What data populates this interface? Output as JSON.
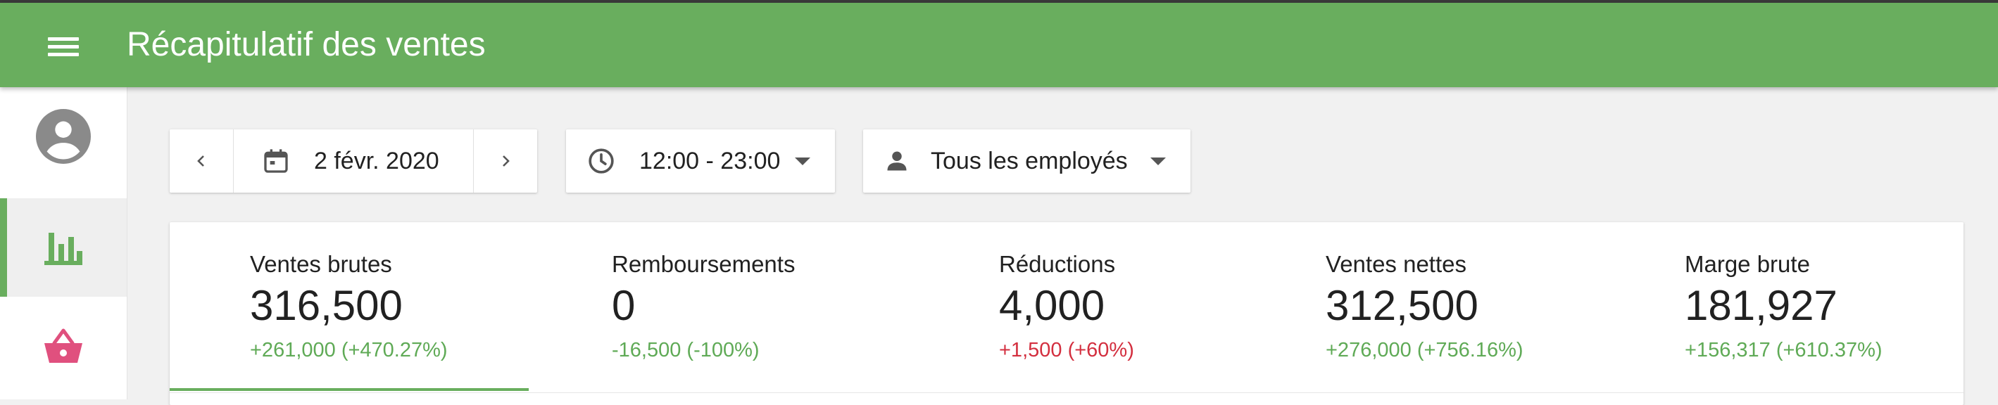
{
  "header": {
    "title": "Récapitulatif des ventes"
  },
  "sidebar": {
    "items": [
      {
        "icon": "account-circle-icon"
      },
      {
        "icon": "bar-chart-icon",
        "active": true
      },
      {
        "icon": "basket-icon"
      }
    ]
  },
  "filters": {
    "date": "2 févr. 2020",
    "time": "12:00 - 23:00",
    "employee": "Tous les employés"
  },
  "metrics": [
    {
      "label": "Ventes brutes",
      "value": "316,500",
      "change": "+261,000 (+470.27%)",
      "trend": "positive"
    },
    {
      "label": "Remboursements",
      "value": "0",
      "change": "-16,500 (-100%)",
      "trend": "positive"
    },
    {
      "label": "Réductions",
      "value": "4,000",
      "change": "+1,500 (+60%)",
      "trend": "negative"
    },
    {
      "label": "Ventes nettes",
      "value": "312,500",
      "change": "+276,000 (+756.16%)",
      "trend": "positive"
    },
    {
      "label": "Marge brute",
      "value": "181,927",
      "change": "+156,317 (+610.37%)",
      "trend": "positive"
    }
  ],
  "colors": {
    "appbar": "#69ae5e",
    "positive": "#5faa56",
    "negative": "#d32f3f",
    "basket_icon": "#e0507e",
    "chart_icon": "#69ae5e"
  }
}
